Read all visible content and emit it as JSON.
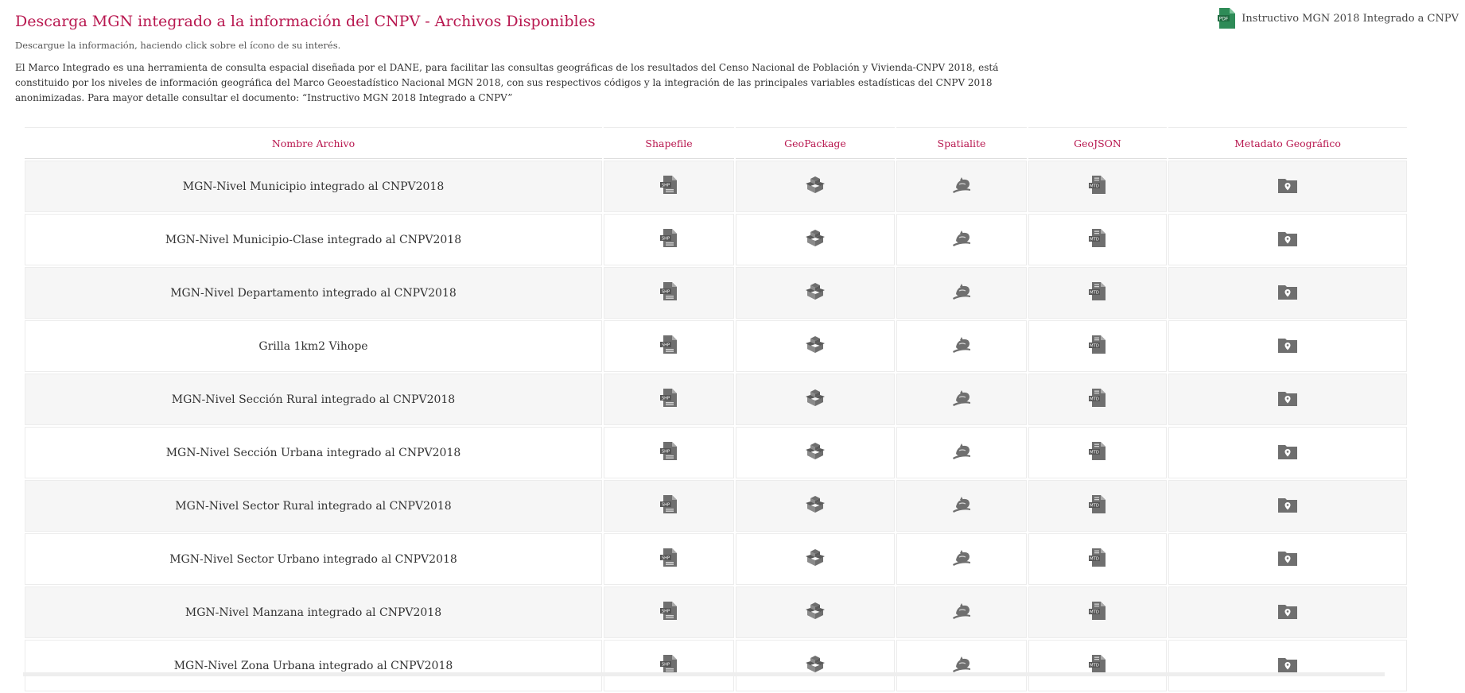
{
  "header": {
    "title": "Descarga MGN integrado a la información del CNPV - Archivos Disponibles",
    "subtitle": "Descargue la información, haciendo click sobre el ícono de su interés.",
    "description": "El Marco Integrado es una herramienta de consulta espacial diseñada por el DANE, para facilitar las consultas geográficas de los resultados del Censo Nacional de Población y Vivienda-CNPV 2018, está constituido por los niveles de información geográfica del Marco Geoestadístico Nacional MGN 2018, con sus respectivos códigos y la integración de las principales variables estadísticas del CNPV 2018 anonimizadas. Para mayor detalle consultar el documento: “Instructivo MGN 2018 Integrado a CNPV”"
  },
  "pdf_link": {
    "label": "Instructivo MGN 2018 Integrado a CNPV",
    "icon": "pdf-icon",
    "icon_text": "PDF",
    "color": "#2e8b57"
  },
  "colors": {
    "accent": "#b8174f",
    "icon_gray": "#6f6f6f",
    "row_alt": "#f6f6f6"
  },
  "table": {
    "columns": [
      "Nombre Archivo",
      "Shapefile",
      "GeoPackage",
      "Spatialite",
      "GeoJSON",
      "Metadato Geográfico"
    ],
    "icon_names": [
      "shapefile-icon",
      "geopackage-icon",
      "spatialite-icon",
      "geojson-icon",
      "metadata-icon"
    ],
    "icon_labels": {
      "shp": "SHP",
      "json": "MTD"
    },
    "rows": [
      "MGN-Nivel Municipio integrado al CNPV2018",
      "MGN-Nivel Municipio-Clase integrado al CNPV2018",
      "MGN-Nivel Departamento integrado al CNPV2018",
      "Grilla 1km2 Vihope",
      "MGN-Nivel Sección Rural integrado al CNPV2018",
      "MGN-Nivel Sección Urbana integrado al CNPV2018",
      "MGN-Nivel Sector Rural integrado al CNPV2018",
      "MGN-Nivel Sector Urbano integrado al CNPV2018",
      "MGN-Nivel Manzana integrado al CNPV2018",
      "MGN-Nivel Zona Urbana integrado al CNPV2018"
    ]
  }
}
